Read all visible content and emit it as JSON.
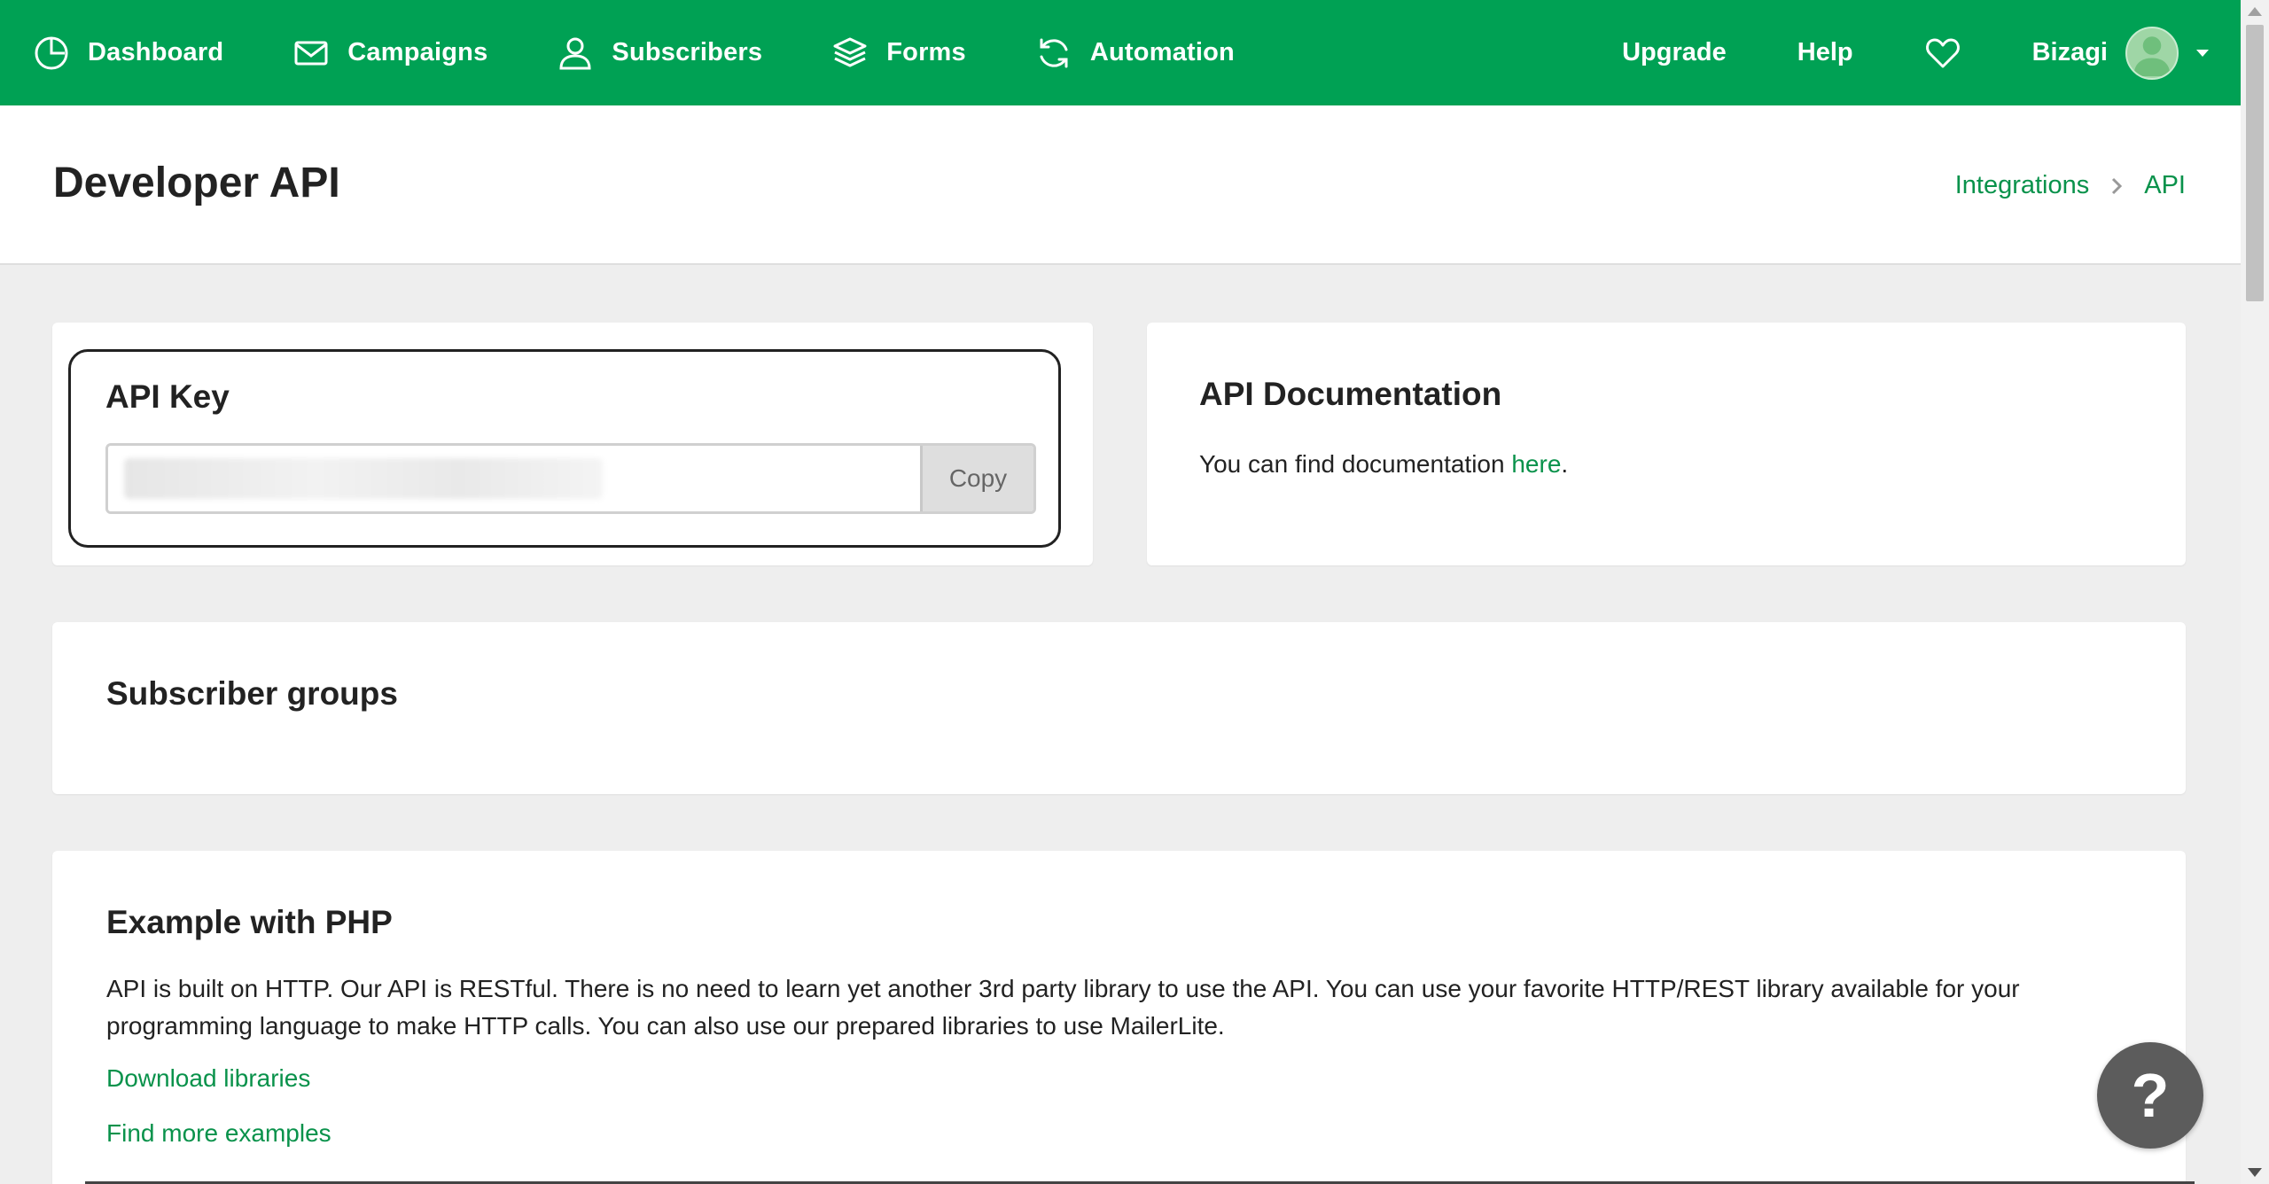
{
  "nav": {
    "items": [
      {
        "label": "Dashboard",
        "icon": "dashboard-clock-icon"
      },
      {
        "label": "Campaigns",
        "icon": "envelope-icon"
      },
      {
        "label": "Subscribers",
        "icon": "user-icon"
      },
      {
        "label": "Forms",
        "icon": "layers-icon"
      },
      {
        "label": "Automation",
        "icon": "refresh-icon"
      }
    ],
    "upgrade": "Upgrade",
    "help": "Help",
    "user_name": "Bizagi",
    "brand_color": "#00a154"
  },
  "header": {
    "title": "Developer API",
    "breadcrumb": [
      "Integrations",
      "API"
    ]
  },
  "api_key": {
    "title": "API Key",
    "copy_label": "Copy"
  },
  "api_docs": {
    "title": "API Documentation",
    "text_before": "You can find documentation ",
    "link": "here",
    "text_after": "."
  },
  "groups": {
    "title": "Subscriber groups"
  },
  "php": {
    "title": "Example with PHP",
    "description": "API is built on HTTP. Our API is RESTful. There is no need to learn yet another 3rd party library to use the API. You can use your favorite HTTP/REST library available for your programming language to make HTTP calls. You can also use our prepared libraries to use MailerLite.",
    "link_download": "Download libraries",
    "link_examples": "Find more examples"
  },
  "help_fab": "?",
  "link_color": "#09924b"
}
